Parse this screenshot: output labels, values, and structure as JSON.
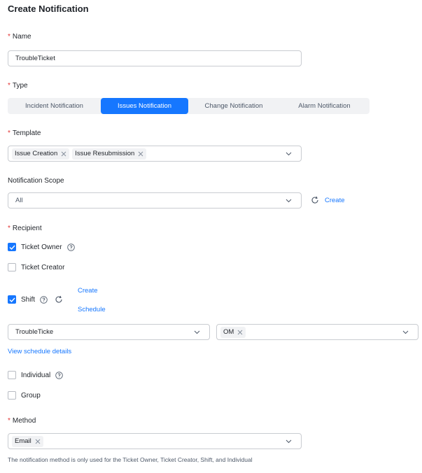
{
  "page": {
    "title": "Create Notification"
  },
  "name_field": {
    "label": "Name",
    "value": "TroubleTicket"
  },
  "type_field": {
    "label": "Type",
    "options": [
      "Incident Notification",
      "Issues Notification",
      "Change Notification",
      "Alarm Notification"
    ],
    "selected": "Issues Notification"
  },
  "template_field": {
    "label": "Template",
    "tags": [
      "Issue Creation",
      "Issue Resubmission"
    ]
  },
  "scope_field": {
    "label": "Notification Scope",
    "value": "All",
    "create_link": "Create"
  },
  "recipient": {
    "label": "Recipient",
    "ticket_owner": {
      "label": "Ticket Owner",
      "checked": true
    },
    "ticket_creator": {
      "label": "Ticket Creator",
      "checked": false
    },
    "shift": {
      "label": "Shift",
      "checked": true,
      "create_link": "Create",
      "schedule_link": "Schedule"
    },
    "shift_select": {
      "value": "TroubleTicke"
    },
    "shift_tag_select": {
      "tags": [
        "OM"
      ]
    },
    "view_schedule_link": "View schedule details",
    "individual": {
      "label": "Individual",
      "checked": false
    },
    "group": {
      "label": "Group",
      "checked": false
    }
  },
  "method_field": {
    "label": "Method",
    "tags": [
      "Email"
    ],
    "hint": "The notification method is only used for the Ticket Owner, Ticket Creator, Shift, and Individual"
  },
  "colors": {
    "accent": "#1677ff",
    "required": "#e23434",
    "border": "#c9ccd1"
  }
}
